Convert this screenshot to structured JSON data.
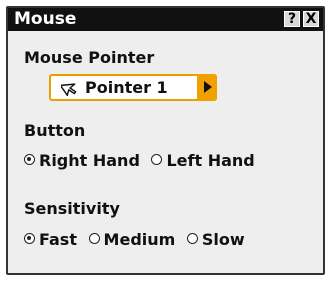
{
  "window": {
    "title": "Mouse",
    "help_label": "?",
    "close_label": "X"
  },
  "mouse_pointer": {
    "label": "Mouse Pointer",
    "value": "Pointer 1"
  },
  "button": {
    "label": "Button",
    "options": [
      {
        "label": "Right Hand",
        "selected": true
      },
      {
        "label": "Left Hand",
        "selected": false
      }
    ]
  },
  "sensitivity": {
    "label": "Sensitivity",
    "options": [
      {
        "label": "Fast",
        "selected": true
      },
      {
        "label": "Medium",
        "selected": false
      },
      {
        "label": "Slow",
        "selected": false
      }
    ]
  }
}
